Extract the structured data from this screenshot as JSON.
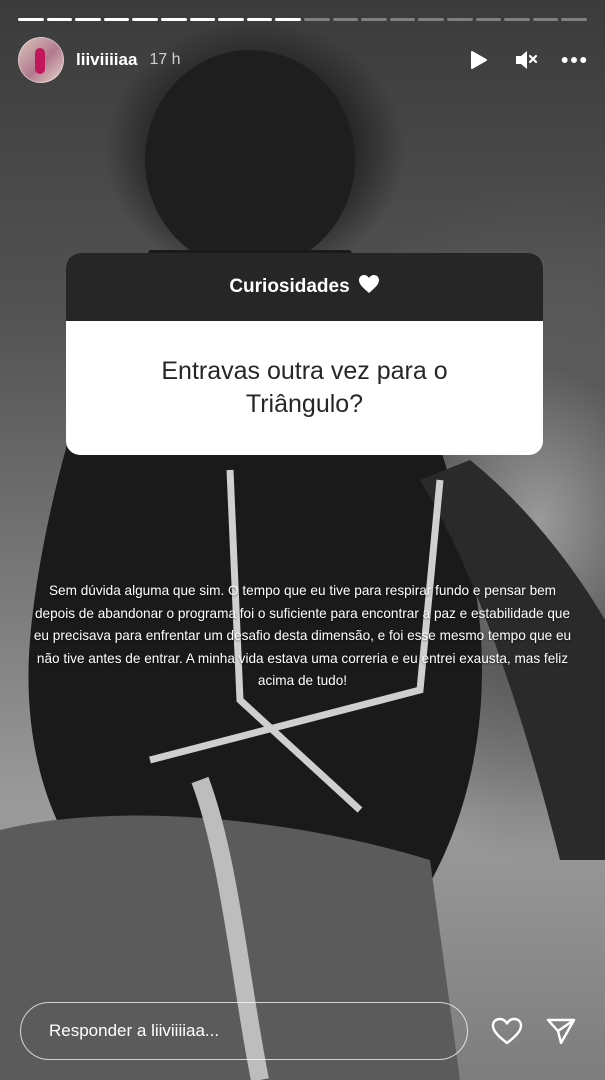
{
  "story": {
    "progress_segments_total": 20,
    "progress_segments_done": 10
  },
  "header": {
    "username": "liiviiiiaa",
    "time": "17 h",
    "icons": [
      "play-icon",
      "mute-icon",
      "more-icon"
    ]
  },
  "question_box": {
    "title": "Curiosidades",
    "title_icon": "white-heart-icon",
    "question": "Entravas outra vez para o Triângulo?"
  },
  "answer": {
    "text": "Sem dúvida alguma que sim. O tempo que eu tive para respirar fundo e pensar bem depois de abandonar o programa foi o suficiente para encontrar a paz e estabilidade que eu precisava para enfrentar um desafio desta dimensão, e foi esse mesmo tempo que eu não tive antes de entrar. A minha vida estava uma correria e eu entrei exausta, mas feliz acima de tudo!"
  },
  "footer": {
    "reply_placeholder": "Responder a liiviiiiaa...",
    "icons": [
      "heart-icon",
      "send-icon"
    ]
  },
  "colors": {
    "card_header_bg": "#262626",
    "card_body_bg": "#ffffff",
    "text_primary": "#ffffff"
  }
}
